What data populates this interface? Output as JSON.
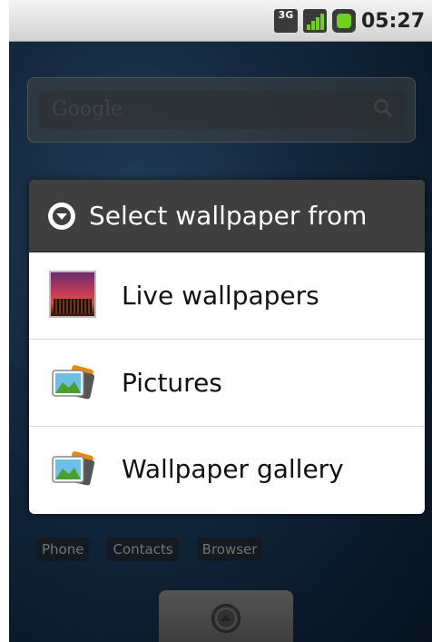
{
  "status_bar": {
    "network": "3G",
    "time": "05:27"
  },
  "home": {
    "search_placeholder": "Google",
    "dock": [
      "Phone",
      "Contacts",
      "Browser"
    ]
  },
  "dialog": {
    "title": "Select wallpaper from",
    "options": [
      {
        "label": "Live wallpapers",
        "icon": "live-wallpaper-icon"
      },
      {
        "label": "Pictures",
        "icon": "pictures-icon"
      },
      {
        "label": "Wallpaper gallery",
        "icon": "gallery-icon"
      }
    ]
  },
  "colors": {
    "dialog_header": "#3f3f3f",
    "signal_green": "#6fd11e"
  }
}
